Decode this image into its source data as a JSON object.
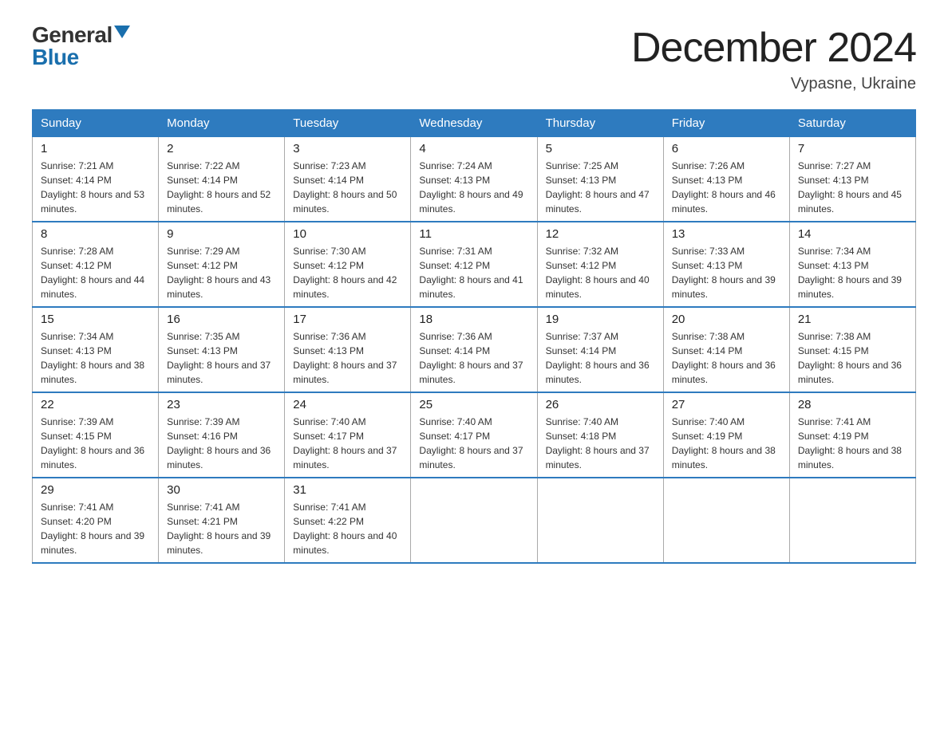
{
  "logo": {
    "general": "General",
    "blue": "Blue"
  },
  "title": "December 2024",
  "location": "Vypasne, Ukraine",
  "days_of_week": [
    "Sunday",
    "Monday",
    "Tuesday",
    "Wednesday",
    "Thursday",
    "Friday",
    "Saturday"
  ],
  "weeks": [
    [
      {
        "num": "1",
        "sunrise": "7:21 AM",
        "sunset": "4:14 PM",
        "daylight": "8 hours and 53 minutes."
      },
      {
        "num": "2",
        "sunrise": "7:22 AM",
        "sunset": "4:14 PM",
        "daylight": "8 hours and 52 minutes."
      },
      {
        "num": "3",
        "sunrise": "7:23 AM",
        "sunset": "4:14 PM",
        "daylight": "8 hours and 50 minutes."
      },
      {
        "num": "4",
        "sunrise": "7:24 AM",
        "sunset": "4:13 PM",
        "daylight": "8 hours and 49 minutes."
      },
      {
        "num": "5",
        "sunrise": "7:25 AM",
        "sunset": "4:13 PM",
        "daylight": "8 hours and 47 minutes."
      },
      {
        "num": "6",
        "sunrise": "7:26 AM",
        "sunset": "4:13 PM",
        "daylight": "8 hours and 46 minutes."
      },
      {
        "num": "7",
        "sunrise": "7:27 AM",
        "sunset": "4:13 PM",
        "daylight": "8 hours and 45 minutes."
      }
    ],
    [
      {
        "num": "8",
        "sunrise": "7:28 AM",
        "sunset": "4:12 PM",
        "daylight": "8 hours and 44 minutes."
      },
      {
        "num": "9",
        "sunrise": "7:29 AM",
        "sunset": "4:12 PM",
        "daylight": "8 hours and 43 minutes."
      },
      {
        "num": "10",
        "sunrise": "7:30 AM",
        "sunset": "4:12 PM",
        "daylight": "8 hours and 42 minutes."
      },
      {
        "num": "11",
        "sunrise": "7:31 AM",
        "sunset": "4:12 PM",
        "daylight": "8 hours and 41 minutes."
      },
      {
        "num": "12",
        "sunrise": "7:32 AM",
        "sunset": "4:12 PM",
        "daylight": "8 hours and 40 minutes."
      },
      {
        "num": "13",
        "sunrise": "7:33 AM",
        "sunset": "4:13 PM",
        "daylight": "8 hours and 39 minutes."
      },
      {
        "num": "14",
        "sunrise": "7:34 AM",
        "sunset": "4:13 PM",
        "daylight": "8 hours and 39 minutes."
      }
    ],
    [
      {
        "num": "15",
        "sunrise": "7:34 AM",
        "sunset": "4:13 PM",
        "daylight": "8 hours and 38 minutes."
      },
      {
        "num": "16",
        "sunrise": "7:35 AM",
        "sunset": "4:13 PM",
        "daylight": "8 hours and 37 minutes."
      },
      {
        "num": "17",
        "sunrise": "7:36 AM",
        "sunset": "4:13 PM",
        "daylight": "8 hours and 37 minutes."
      },
      {
        "num": "18",
        "sunrise": "7:36 AM",
        "sunset": "4:14 PM",
        "daylight": "8 hours and 37 minutes."
      },
      {
        "num": "19",
        "sunrise": "7:37 AM",
        "sunset": "4:14 PM",
        "daylight": "8 hours and 36 minutes."
      },
      {
        "num": "20",
        "sunrise": "7:38 AM",
        "sunset": "4:14 PM",
        "daylight": "8 hours and 36 minutes."
      },
      {
        "num": "21",
        "sunrise": "7:38 AM",
        "sunset": "4:15 PM",
        "daylight": "8 hours and 36 minutes."
      }
    ],
    [
      {
        "num": "22",
        "sunrise": "7:39 AM",
        "sunset": "4:15 PM",
        "daylight": "8 hours and 36 minutes."
      },
      {
        "num": "23",
        "sunrise": "7:39 AM",
        "sunset": "4:16 PM",
        "daylight": "8 hours and 36 minutes."
      },
      {
        "num": "24",
        "sunrise": "7:40 AM",
        "sunset": "4:17 PM",
        "daylight": "8 hours and 37 minutes."
      },
      {
        "num": "25",
        "sunrise": "7:40 AM",
        "sunset": "4:17 PM",
        "daylight": "8 hours and 37 minutes."
      },
      {
        "num": "26",
        "sunrise": "7:40 AM",
        "sunset": "4:18 PM",
        "daylight": "8 hours and 37 minutes."
      },
      {
        "num": "27",
        "sunrise": "7:40 AM",
        "sunset": "4:19 PM",
        "daylight": "8 hours and 38 minutes."
      },
      {
        "num": "28",
        "sunrise": "7:41 AM",
        "sunset": "4:19 PM",
        "daylight": "8 hours and 38 minutes."
      }
    ],
    [
      {
        "num": "29",
        "sunrise": "7:41 AM",
        "sunset": "4:20 PM",
        "daylight": "8 hours and 39 minutes."
      },
      {
        "num": "30",
        "sunrise": "7:41 AM",
        "sunset": "4:21 PM",
        "daylight": "8 hours and 39 minutes."
      },
      {
        "num": "31",
        "sunrise": "7:41 AM",
        "sunset": "4:22 PM",
        "daylight": "8 hours and 40 minutes."
      },
      null,
      null,
      null,
      null
    ]
  ]
}
